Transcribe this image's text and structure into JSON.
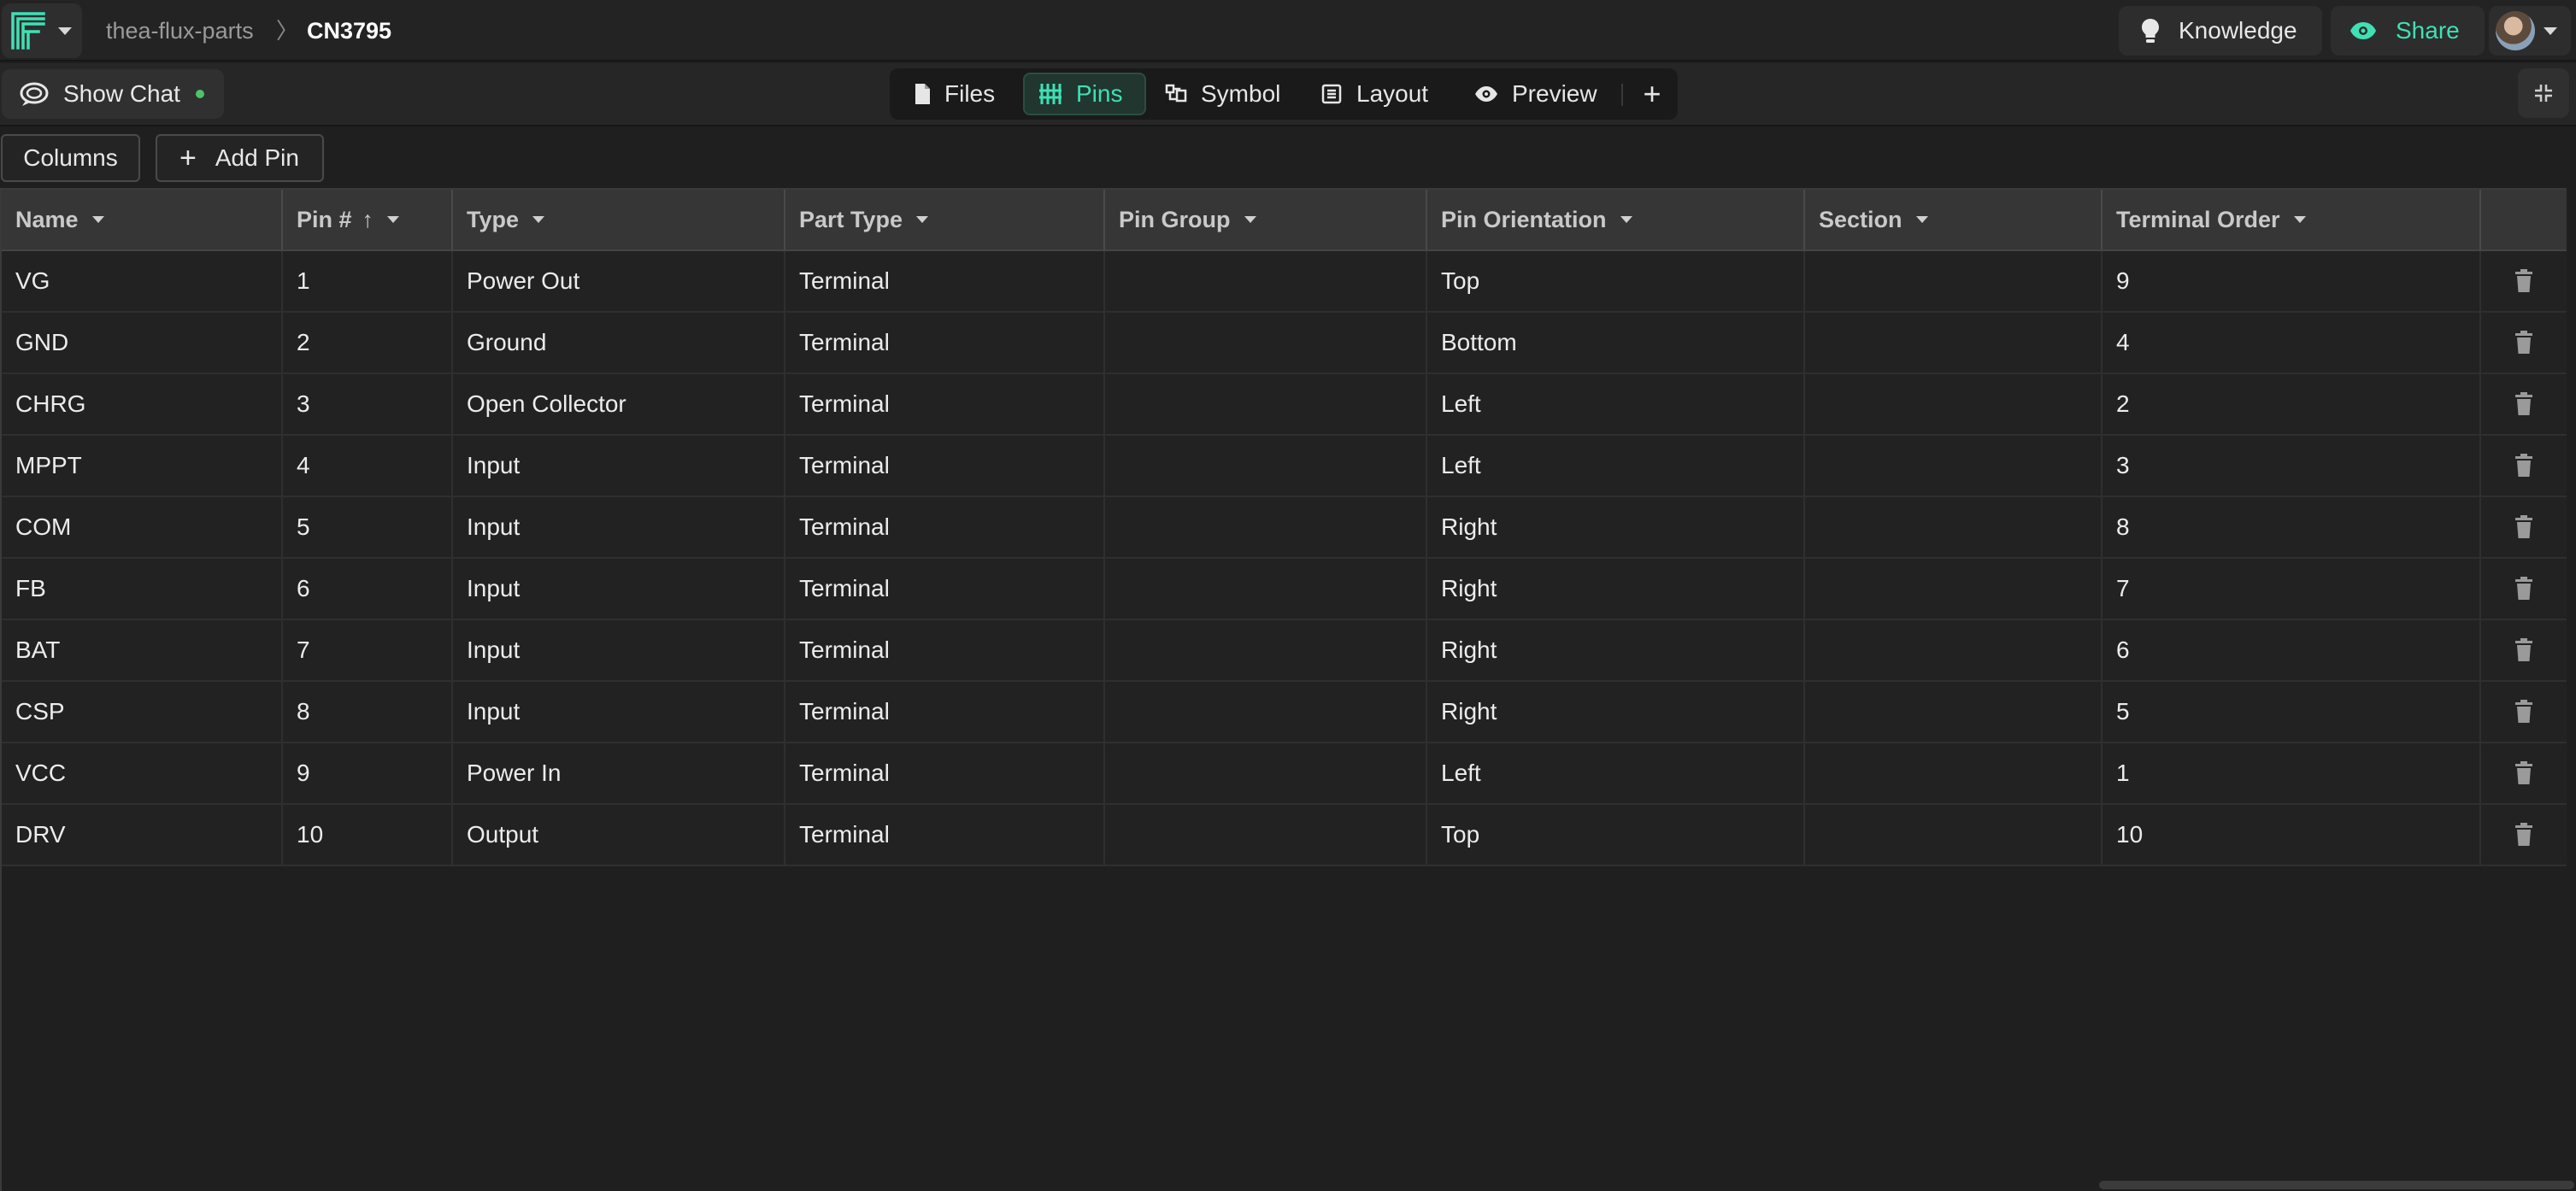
{
  "header": {
    "project": "thea-flux-parts",
    "separator": "〉",
    "part_name": "CN3795",
    "knowledge_label": "Knowledge",
    "share_label": "Share"
  },
  "subbar": {
    "show_chat_label": "Show Chat",
    "tabs": [
      {
        "label": "Files",
        "icon": "file-icon"
      },
      {
        "label": "Pins",
        "icon": "pins-icon",
        "active": true
      },
      {
        "label": "Symbol",
        "icon": "symbol-icon"
      },
      {
        "label": "Layout",
        "icon": "layout-icon"
      },
      {
        "label": "Preview",
        "icon": "eye-icon"
      }
    ],
    "add_tab_label": "+"
  },
  "toolbar": {
    "columns_label": "Columns",
    "add_pin_label": "Add Pin"
  },
  "table": {
    "columns": [
      "Name",
      "Pin #",
      "Type",
      "Part Type",
      "Pin Group",
      "Pin Orientation",
      "Section",
      "Terminal Order"
    ],
    "sort_indicator": "↑",
    "rows": [
      {
        "name": "VG",
        "pin": "1",
        "type": "Power Out",
        "part_type": "Terminal",
        "pin_group": "",
        "orientation": "Top",
        "section": "",
        "terminal_order": "9"
      },
      {
        "name": "GND",
        "pin": "2",
        "type": "Ground",
        "part_type": "Terminal",
        "pin_group": "",
        "orientation": "Bottom",
        "section": "",
        "terminal_order": "4"
      },
      {
        "name": "CHRG",
        "pin": "3",
        "type": "Open Collector",
        "part_type": "Terminal",
        "pin_group": "",
        "orientation": "Left",
        "section": "",
        "terminal_order": "2"
      },
      {
        "name": "MPPT",
        "pin": "4",
        "type": "Input",
        "part_type": "Terminal",
        "pin_group": "",
        "orientation": "Left",
        "section": "",
        "terminal_order": "3"
      },
      {
        "name": "COM",
        "pin": "5",
        "type": "Input",
        "part_type": "Terminal",
        "pin_group": "",
        "orientation": "Right",
        "section": "",
        "terminal_order": "8"
      },
      {
        "name": "FB",
        "pin": "6",
        "type": "Input",
        "part_type": "Terminal",
        "pin_group": "",
        "orientation": "Right",
        "section": "",
        "terminal_order": "7"
      },
      {
        "name": "BAT",
        "pin": "7",
        "type": "Input",
        "part_type": "Terminal",
        "pin_group": "",
        "orientation": "Right",
        "section": "",
        "terminal_order": "6"
      },
      {
        "name": "CSP",
        "pin": "8",
        "type": "Input",
        "part_type": "Terminal",
        "pin_group": "",
        "orientation": "Right",
        "section": "",
        "terminal_order": "5"
      },
      {
        "name": "VCC",
        "pin": "9",
        "type": "Power In",
        "part_type": "Terminal",
        "pin_group": "",
        "orientation": "Left",
        "section": "",
        "terminal_order": "1"
      },
      {
        "name": "DRV",
        "pin": "10",
        "type": "Output",
        "part_type": "Terminal",
        "pin_group": "",
        "orientation": "Top",
        "section": "",
        "terminal_order": "10"
      }
    ]
  },
  "colors": {
    "accent": "#3fe0b5",
    "background": "#1f1f1f",
    "header_row": "#363636",
    "status_dot": "#4cc46a"
  }
}
